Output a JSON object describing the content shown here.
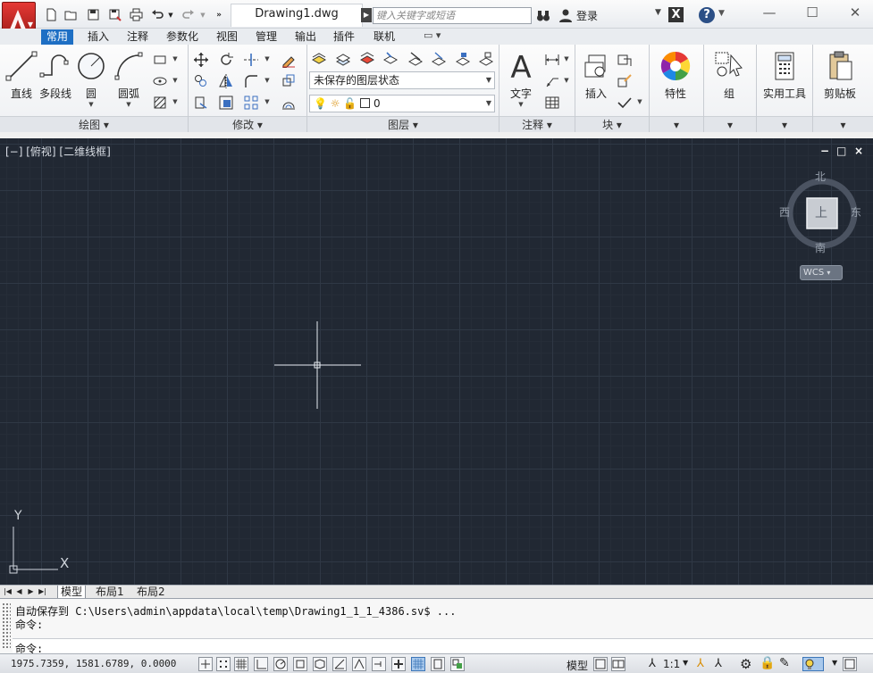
{
  "title_bar": {
    "document_tab": "Drawing1.dwg",
    "search_placeholder": "键入关键字或短语",
    "login_label": "登录"
  },
  "ribbon_tabs": [
    "常用",
    "插入",
    "注释",
    "参数化",
    "视图",
    "管理",
    "输出",
    "插件",
    "联机"
  ],
  "ribbon": {
    "draw": {
      "panel_title": "绘图",
      "line": "直线",
      "polyline": "多段线",
      "circle": "圆",
      "arc": "圆弧"
    },
    "modify": {
      "panel_title": "修改"
    },
    "layers": {
      "panel_title": "图层",
      "layer_state": "未保存的图层状态",
      "current_layer": "0"
    },
    "annotation": {
      "panel_title": "注释",
      "text": "文字"
    },
    "block": {
      "panel_title": "块",
      "insert": "插入"
    },
    "properties": {
      "label": "特性"
    },
    "groups": {
      "label": "组"
    },
    "utilities": {
      "label": "实用工具"
    },
    "clipboard": {
      "label": "剪贴板"
    }
  },
  "viewport": {
    "label": "[−] [俯视] [二维线框]",
    "controls": [
      "−",
      "□",
      "×"
    ],
    "viewcube": {
      "north": "北",
      "south": "南",
      "east": "东",
      "west": "西",
      "face": "上",
      "wcs": "WCS"
    },
    "ucs": {
      "x": "X",
      "y": "Y"
    }
  },
  "layout_tabs": [
    "模型",
    "布局1",
    "布局2"
  ],
  "command": {
    "history": [
      "自动保存到 C:\\Users\\admin\\appdata\\local\\temp\\Drawing1_1_1_4386.sv$ ...",
      "命令:"
    ],
    "prompt": "命令:"
  },
  "status_bar": {
    "coordinates": "1975.7359, 1581.6789, 0.0000",
    "model_label": "模型",
    "annotation_scale": "1:1"
  },
  "colors": {
    "accent": "#1e6fc4",
    "canvas": "#212833",
    "app_button": "#c62828"
  }
}
